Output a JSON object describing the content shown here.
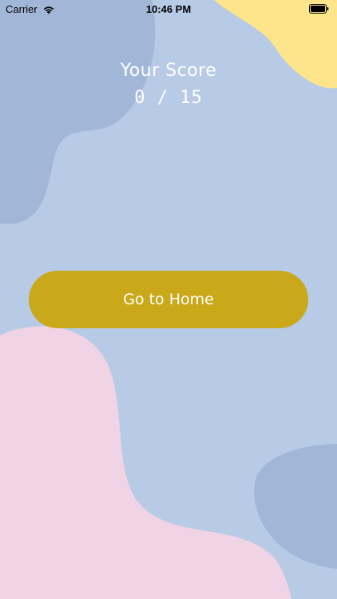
{
  "status_bar": {
    "carrier": "Carrier",
    "time": "10:46 PM"
  },
  "score": {
    "label": "Your Score",
    "value": "0 / 15"
  },
  "actions": {
    "home_label": "Go to Home"
  },
  "colors": {
    "background": "#B7CAE6",
    "blob_blue": "#A2B7D8",
    "blob_yellow": "#FDE58C",
    "blob_pink": "#F0D3E5",
    "button": "#C9A81A",
    "text": "#FFFFFF"
  }
}
